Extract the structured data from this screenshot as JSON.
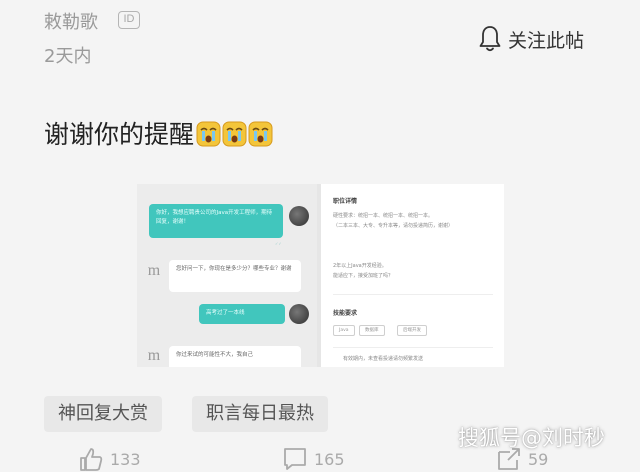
{
  "author": {
    "name": "敕勒歌",
    "badge": "ID"
  },
  "post": {
    "time": "2天内",
    "text": "谢谢你的提醒",
    "emoji_icons": [
      "cry-face-icon",
      "cry-face-icon",
      "cry-face-icon"
    ]
  },
  "header": {
    "follow_label": "关注此帖",
    "follow_icon": "bell-icon"
  },
  "screenshot": {
    "chat": {
      "msg1": "你好，我想应聘贵公司的Java开发工程师，期待回复，谢谢！",
      "msg2": "您好问一下，你现在是多少分？哪些专业？谢谢",
      "msg3": "高考过了一本线",
      "msg4": "你过来试的可能性不大，我自己"
    },
    "job": {
      "section1_title": "职位详情",
      "section1_lines": [
        "硬性要求：统招一本、统招一本、统招一本。",
        "（二本三本、大专、专升本等，请勿投递简历，谢谢）",
        "",
        "2年以上Java开发经验。",
        "能适应下，接受加班了吗？"
      ],
      "section2_title": "技能要求",
      "tags": [
        "Java",
        "数据库",
        "后端开发"
      ],
      "footer_line": "有效期内，未查看投递请勿频繁发送"
    }
  },
  "topics": [
    "神回复大赏",
    "职言每日最热"
  ],
  "watermark": "搜狐号@刘时秒",
  "actions": {
    "like_count": "133",
    "comment_count": "165",
    "share_count": "59"
  },
  "colors": {
    "accent_teal": "#41c6bd",
    "background": "#f4f4f4",
    "emoji_yellow": "#f3c53a"
  }
}
